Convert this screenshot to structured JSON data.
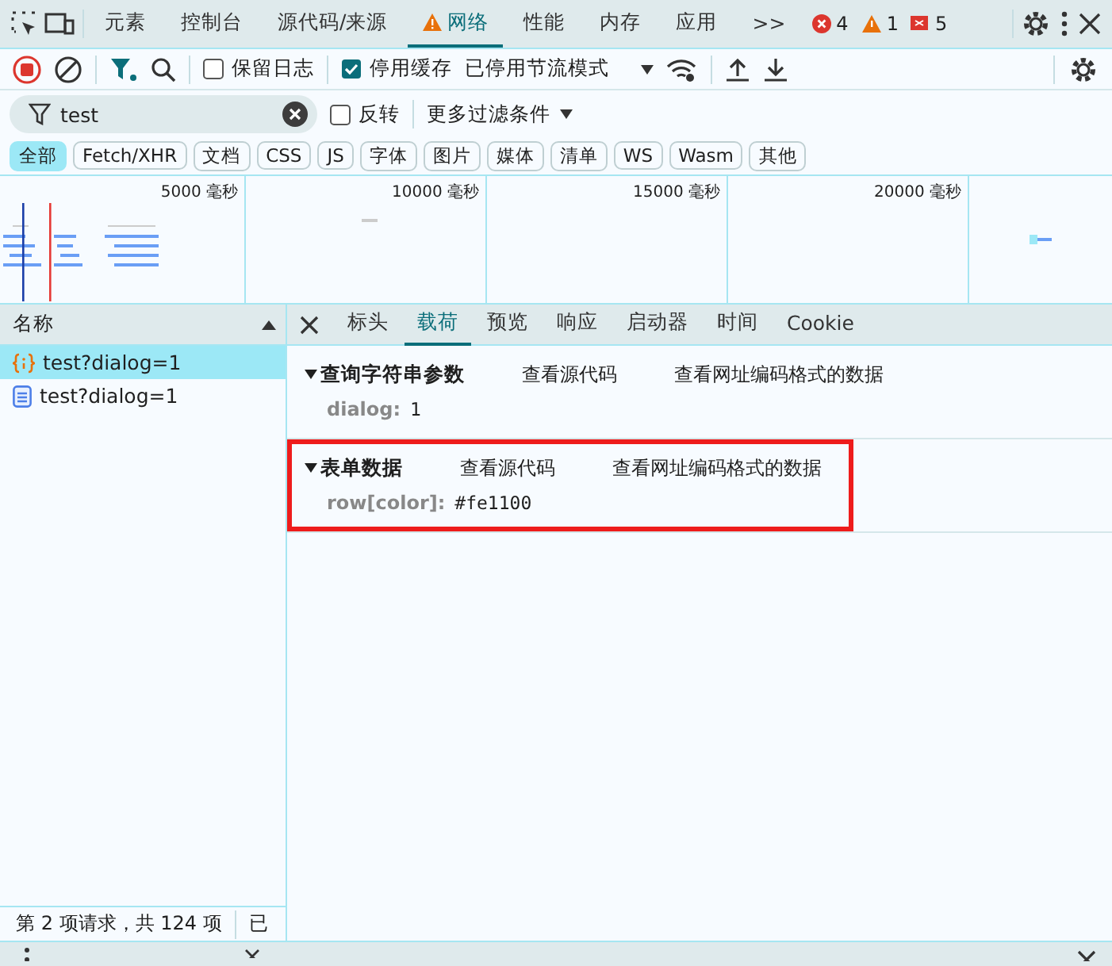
{
  "main_tabs": [
    {
      "label": "元素",
      "selected": false,
      "warning": false
    },
    {
      "label": "控制台",
      "selected": false,
      "warning": false
    },
    {
      "label": "源代码/来源",
      "selected": false,
      "warning": false
    },
    {
      "label": "网络",
      "selected": true,
      "warning": true
    },
    {
      "label": "性能",
      "selected": false,
      "warning": false
    },
    {
      "label": "内存",
      "selected": false,
      "warning": false
    },
    {
      "label": "应用",
      "selected": false,
      "warning": false
    }
  ],
  "more_tabs": ">>",
  "counters": [
    {
      "kind": "error",
      "count": "4"
    },
    {
      "kind": "warning",
      "count": "1"
    },
    {
      "kind": "issue",
      "count": "5"
    }
  ],
  "toolbar": {
    "recording": true,
    "preserve_log": {
      "label": "保留日志",
      "checked": false
    },
    "disable_cache": {
      "label": "停用缓存",
      "checked": true
    },
    "throttle": "已停用节流模式"
  },
  "filter": {
    "value": "test",
    "invert": {
      "label": "反转",
      "checked": false
    },
    "more_filters": "更多过滤条件"
  },
  "type_filters": [
    {
      "label": "全部",
      "selected": true
    },
    {
      "label": "Fetch/XHR",
      "selected": false
    },
    {
      "label": "文档",
      "selected": false
    },
    {
      "label": "CSS",
      "selected": false
    },
    {
      "label": "JS",
      "selected": false
    },
    {
      "label": "字体",
      "selected": false
    },
    {
      "label": "图片",
      "selected": false
    },
    {
      "label": "媒体",
      "selected": false
    },
    {
      "label": "清单",
      "selected": false
    },
    {
      "label": "WS",
      "selected": false
    },
    {
      "label": "Wasm",
      "selected": false
    },
    {
      "label": "其他",
      "selected": false
    }
  ],
  "overview": {
    "ticks": [
      "5000 毫秒",
      "10000 毫秒",
      "15000 毫秒",
      "20000 毫秒"
    ]
  },
  "requests": {
    "column": "名称",
    "rows": [
      {
        "name": "test?dialog=1",
        "kind": "fetch",
        "selected": true
      },
      {
        "name": "test?dialog=1",
        "kind": "document",
        "selected": false
      }
    ]
  },
  "detail_tabs": [
    {
      "label": "标头",
      "selected": false
    },
    {
      "label": "载荷",
      "selected": true
    },
    {
      "label": "预览",
      "selected": false
    },
    {
      "label": "响应",
      "selected": false
    },
    {
      "label": "启动器",
      "selected": false
    },
    {
      "label": "时间",
      "selected": false
    },
    {
      "label": "Cookie",
      "selected": false
    }
  ],
  "payload": [
    {
      "title": "查询字符串参数",
      "expanded": true,
      "highlighted": false,
      "actions": [
        "查看源代码",
        "查看网址编码格式的数据"
      ],
      "params": [
        {
          "key": "dialog:",
          "value": "1"
        }
      ]
    },
    {
      "title": "表单数据",
      "expanded": true,
      "highlighted": true,
      "actions": [
        "查看源代码",
        "查看网址编码格式的数据"
      ],
      "params": [
        {
          "key": "row[color]:",
          "value": "#fe1100"
        }
      ]
    }
  ],
  "status": {
    "summary": "第 2 项请求，共 124 项",
    "transferred": "已"
  }
}
